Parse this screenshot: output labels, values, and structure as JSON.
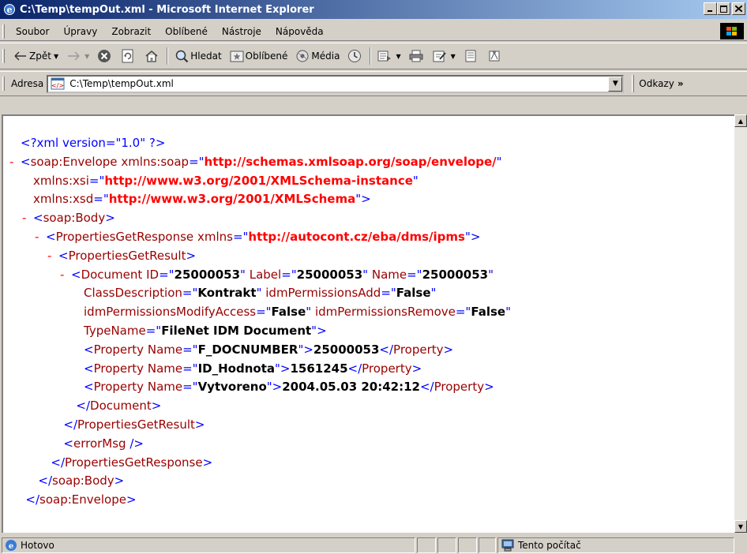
{
  "window": {
    "title": "C:\\Temp\\tempOut.xml - Microsoft Internet Explorer"
  },
  "menu": {
    "items": [
      "Soubor",
      "Úpravy",
      "Zobrazit",
      "Oblíbené",
      "Nástroje",
      "Nápověda"
    ]
  },
  "toolbar": {
    "back": "Zpět",
    "search": "Hledat",
    "favorites": "Oblíbené",
    "media": "Média"
  },
  "address": {
    "label": "Adresa",
    "value": "C:\\Temp\\tempOut.xml",
    "links": "Odkazy"
  },
  "xml_lines": [
    {
      "indent": 0,
      "minus": "",
      "html": "<span class='pi'>&lt;?xml version=\"1.0\" ?&gt;</span>"
    },
    {
      "indent": 0,
      "minus": "-",
      "html": "<span class='b'>&lt;</span><span class='t'>soap:Envelope</span> <span class='ak'>xmlns:soap</span><span class='b'>=\"</span><span class='avred'>http://schemas.xmlsoap.org/soap/envelope/</span><span class='b'>\"</span>"
    },
    {
      "indent": 1,
      "minus": "",
      "html": "<span class='ak'>xmlns:xsi</span><span class='b'>=\"</span><span class='avred'>http://www.w3.org/2001/XMLSchema-instance</span><span class='b'>\"</span>"
    },
    {
      "indent": 1,
      "minus": "",
      "html": "<span class='ak'>xmlns:xsd</span><span class='b'>=\"</span><span class='avred'>http://www.w3.org/2001/XMLSchema</span><span class='b'>\"&gt;</span>"
    },
    {
      "indent": 1,
      "minus": "-",
      "html": "<span class='b'>&lt;</span><span class='t'>soap:Body</span><span class='b'>&gt;</span>"
    },
    {
      "indent": 2,
      "minus": "-",
      "html": "<span class='b'>&lt;</span><span class='t'>PropertiesGetResponse</span> <span class='ak'>xmlns</span><span class='b'>=\"</span><span class='avred'>http://autocont.cz/eba/dms/ipms</span><span class='b'>\"&gt;</span>"
    },
    {
      "indent": 3,
      "minus": "-",
      "html": "<span class='b'>&lt;</span><span class='t'>PropertiesGetResult</span><span class='b'>&gt;</span>"
    },
    {
      "indent": 4,
      "minus": "-",
      "html": "<span class='b'>&lt;</span><span class='t'>Document</span> <span class='ak'>ID</span><span class='b'>=\"</span><span class='av'>25000053</span><span class='b'>\"</span> <span class='ak'>Label</span><span class='b'>=\"</span><span class='av'>25000053</span><span class='b'>\"</span> <span class='ak'>Name</span><span class='b'>=\"</span><span class='av'>25000053</span><span class='b'>\"</span>"
    },
    {
      "indent": 5,
      "minus": "",
      "html": "<span class='ak'>ClassDescription</span><span class='b'>=\"</span><span class='av'>Kontrakt</span><span class='b'>\"</span> <span class='ak'>idmPermissionsAdd</span><span class='b'>=\"</span><span class='av'>False</span><span class='b'>\"</span>"
    },
    {
      "indent": 5,
      "minus": "",
      "html": "<span class='ak'>idmPermissionsModifyAccess</span><span class='b'>=\"</span><span class='av'>False</span><span class='b'>\"</span> <span class='ak'>idmPermissionsRemove</span><span class='b'>=\"</span><span class='av'>False</span><span class='b'>\"</span>"
    },
    {
      "indent": 5,
      "minus": "",
      "html": "<span class='ak'>TypeName</span><span class='b'>=\"</span><span class='av'>FileNet IDM Document</span><span class='b'>\"&gt;</span>"
    },
    {
      "indent": 5,
      "minus": "",
      "html": "<span class='b'>&lt;</span><span class='t'>Property</span> <span class='ak'>Name</span><span class='b'>=\"</span><span class='av'>F_DOCNUMBER</span><span class='b'>\"&gt;</span><span class='tx'>25000053</span><span class='b'>&lt;/</span><span class='t'>Property</span><span class='b'>&gt;</span>"
    },
    {
      "indent": 5,
      "minus": "",
      "html": "<span class='b'>&lt;</span><span class='t'>Property</span> <span class='ak'>Name</span><span class='b'>=\"</span><span class='av'>ID_Hodnota</span><span class='b'>\"&gt;</span><span class='tx'>1561245</span><span class='b'>&lt;/</span><span class='t'>Property</span><span class='b'>&gt;</span>"
    },
    {
      "indent": 5,
      "minus": "",
      "html": "<span class='b'>&lt;</span><span class='t'>Property</span> <span class='ak'>Name</span><span class='b'>=\"</span><span class='av'>Vytvoreno</span><span class='b'>\"&gt;</span><span class='tx'>2004.05.03 20:42:12</span><span class='b'>&lt;/</span><span class='t'>Property</span><span class='b'>&gt;</span>"
    },
    {
      "indent": 4.4,
      "minus": "",
      "html": "<span class='b'>&lt;/</span><span class='t'>Document</span><span class='b'>&gt;</span>"
    },
    {
      "indent": 3.4,
      "minus": "",
      "html": "<span class='b'>&lt;/</span><span class='t'>PropertiesGetResult</span><span class='b'>&gt;</span>"
    },
    {
      "indent": 3.4,
      "minus": "",
      "html": "<span class='b'>&lt;</span><span class='t'>errorMsg</span> <span class='b'>/&gt;</span>"
    },
    {
      "indent": 2.4,
      "minus": "",
      "html": "<span class='b'>&lt;/</span><span class='t'>PropertiesGetResponse</span><span class='b'>&gt;</span>"
    },
    {
      "indent": 1.4,
      "minus": "",
      "html": "<span class='b'>&lt;/</span><span class='t'>soap:Body</span><span class='b'>&gt;</span>"
    },
    {
      "indent": 0.4,
      "minus": "",
      "html": "<span class='b'>&lt;/</span><span class='t'>soap:Envelope</span><span class='b'>&gt;</span>"
    }
  ],
  "status": {
    "text": "Hotovo",
    "zone": "Tento počítač"
  }
}
